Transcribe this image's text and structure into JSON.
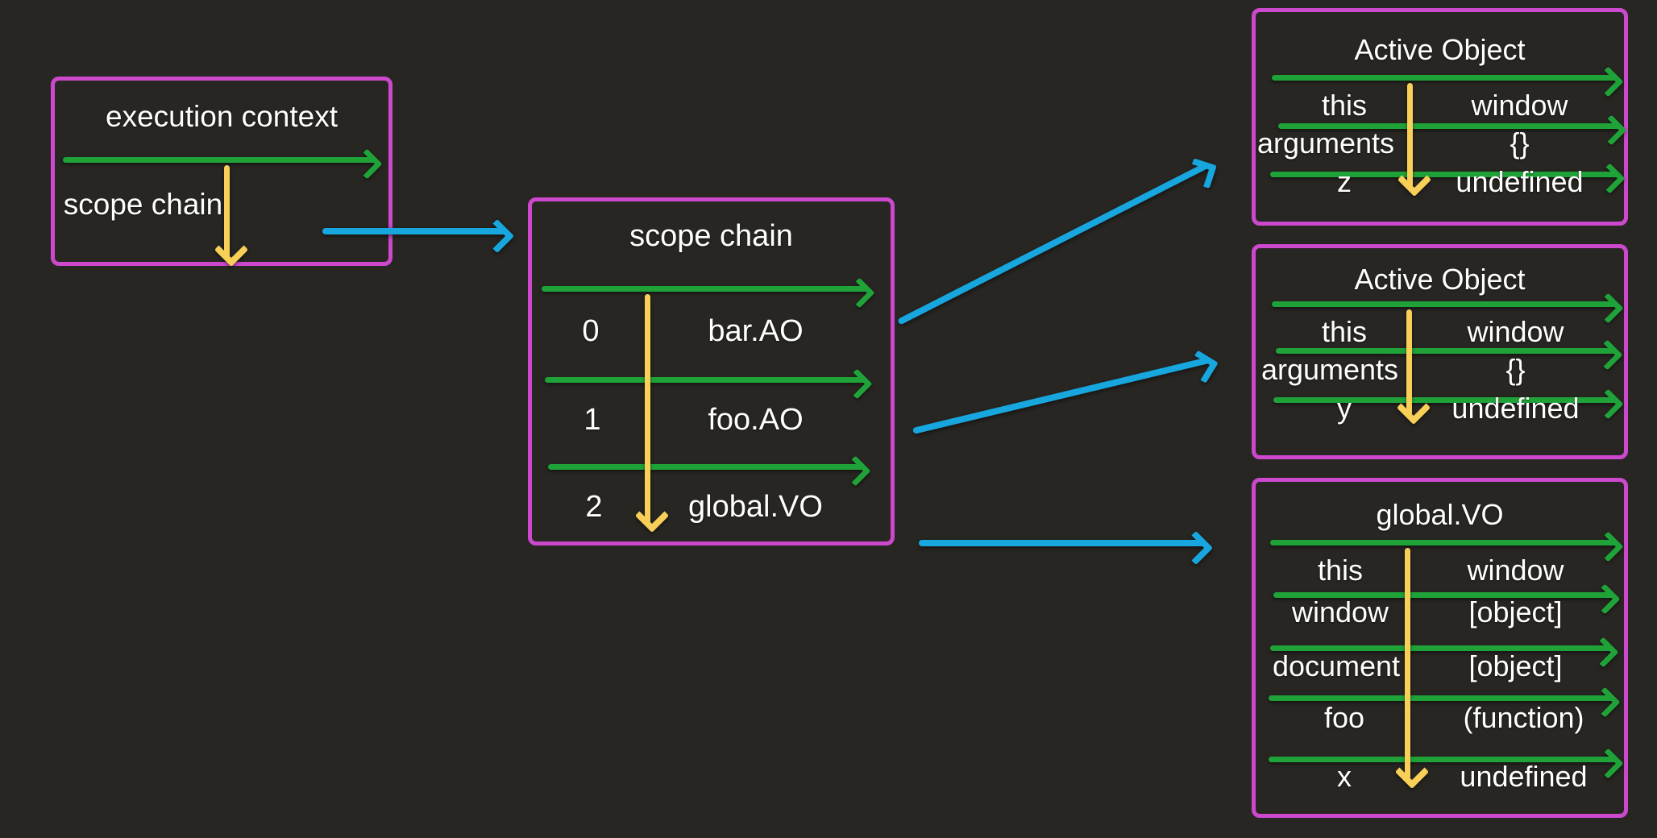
{
  "diagram": {
    "title": "JavaScript execution context and scope chain",
    "background_color": "#282622",
    "box_border_color": "#cc48cc",
    "separator_color": "#1fa339",
    "pointer_color": "#f8cf57",
    "connector_color": "#17a6dd"
  },
  "execution_context_box": {
    "title": "execution context",
    "rows": [
      {
        "key": "scope chain",
        "value": ""
      }
    ]
  },
  "scope_chain_box": {
    "title": "scope chain",
    "rows": [
      {
        "key": "0",
        "value": "bar.AO"
      },
      {
        "key": "1",
        "value": "foo.AO"
      },
      {
        "key": "2",
        "value": "global.VO"
      }
    ]
  },
  "bar_active_object_box": {
    "title": "Active Object",
    "rows": [
      {
        "key": "this",
        "value": "window"
      },
      {
        "key": "arguments",
        "value": "{}"
      },
      {
        "key": "z",
        "value": "undefined"
      }
    ]
  },
  "foo_active_object_box": {
    "title": "Active Object",
    "rows": [
      {
        "key": "this",
        "value": "window"
      },
      {
        "key": "arguments",
        "value": "{}"
      },
      {
        "key": "y",
        "value": "undefined"
      }
    ]
  },
  "global_vo_box": {
    "title": "global.VO",
    "rows": [
      {
        "key": "this",
        "value": "window"
      },
      {
        "key": "window",
        "value": "[object]"
      },
      {
        "key": "document",
        "value": "[object]"
      },
      {
        "key": "foo",
        "value": "(function)"
      },
      {
        "key": "x",
        "value": "undefined"
      }
    ]
  }
}
